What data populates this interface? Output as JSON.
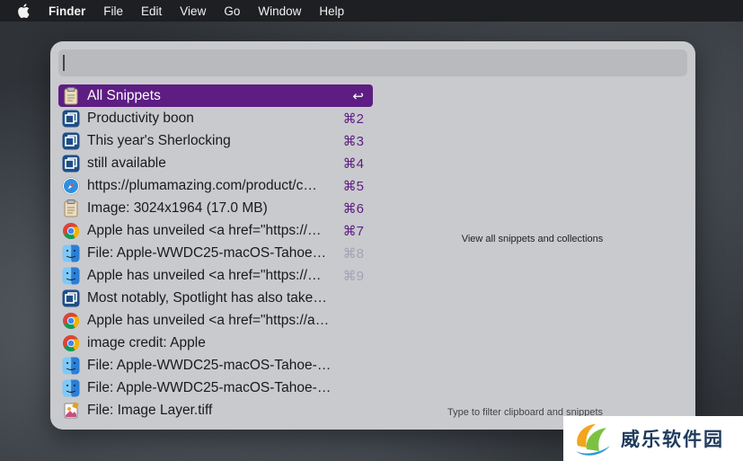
{
  "menubar": {
    "app": "Finder",
    "items": [
      "File",
      "Edit",
      "View",
      "Go",
      "Window",
      "Help"
    ]
  },
  "search": {
    "value": ""
  },
  "list": [
    {
      "label": "All Snippets",
      "shortcut": "↩",
      "icon": "clipboard-icon",
      "selected": true
    },
    {
      "label": "Productivity boon",
      "shortcut": "⌘2",
      "icon": "snippet-app-icon"
    },
    {
      "label": "This year's Sherlocking",
      "shortcut": "⌘3",
      "icon": "snippet-app-icon"
    },
    {
      "label": "still available",
      "shortcut": "⌘4",
      "icon": "snippet-app-icon"
    },
    {
      "label": "https://plumamazing.com/product/c…",
      "shortcut": "⌘5",
      "icon": "safari-icon"
    },
    {
      "label": "Image: 3024x1964 (17.0 MB)",
      "shortcut": "⌘6",
      "icon": "clipboard-icon"
    },
    {
      "label": "Apple has unveiled <a href=\"https://…",
      "shortcut": "⌘7",
      "icon": "chrome-icon"
    },
    {
      "label": "File: Apple-WWDC25-macOS-Tahoe…",
      "shortcut": "⌘8",
      "icon": "finder-icon"
    },
    {
      "label": "Apple has unveiled <a href=\"https://…",
      "shortcut": "⌘9",
      "icon": "finder-icon"
    },
    {
      "label": "Most notably, Spotlight has also taken o…",
      "shortcut": "",
      "icon": "snippet-app-icon"
    },
    {
      "label": "Apple has unveiled <a href=\"https://appl…",
      "shortcut": "",
      "icon": "chrome-icon"
    },
    {
      "label": "image credit: Apple",
      "shortcut": "",
      "icon": "chrome-icon"
    },
    {
      "label": "File: Apple-WWDC25-macOS-Tahoe-26…",
      "shortcut": "",
      "icon": "finder-icon"
    },
    {
      "label": "File: Apple-WWDC25-macOS-Tahoe-26…",
      "shortcut": "",
      "icon": "finder-icon"
    },
    {
      "label": "File: Image Layer.tiff",
      "shortcut": "",
      "icon": "preview-icon"
    }
  ],
  "detail": {
    "text": "View all snippets and collections"
  },
  "hint": {
    "text": "Type to filter clipboard and snippets"
  },
  "watermark": {
    "text": "威乐软件园"
  },
  "colors": {
    "accent": "#5e1d83",
    "panel": "#c9cace",
    "menubar": "#1e1f22"
  }
}
